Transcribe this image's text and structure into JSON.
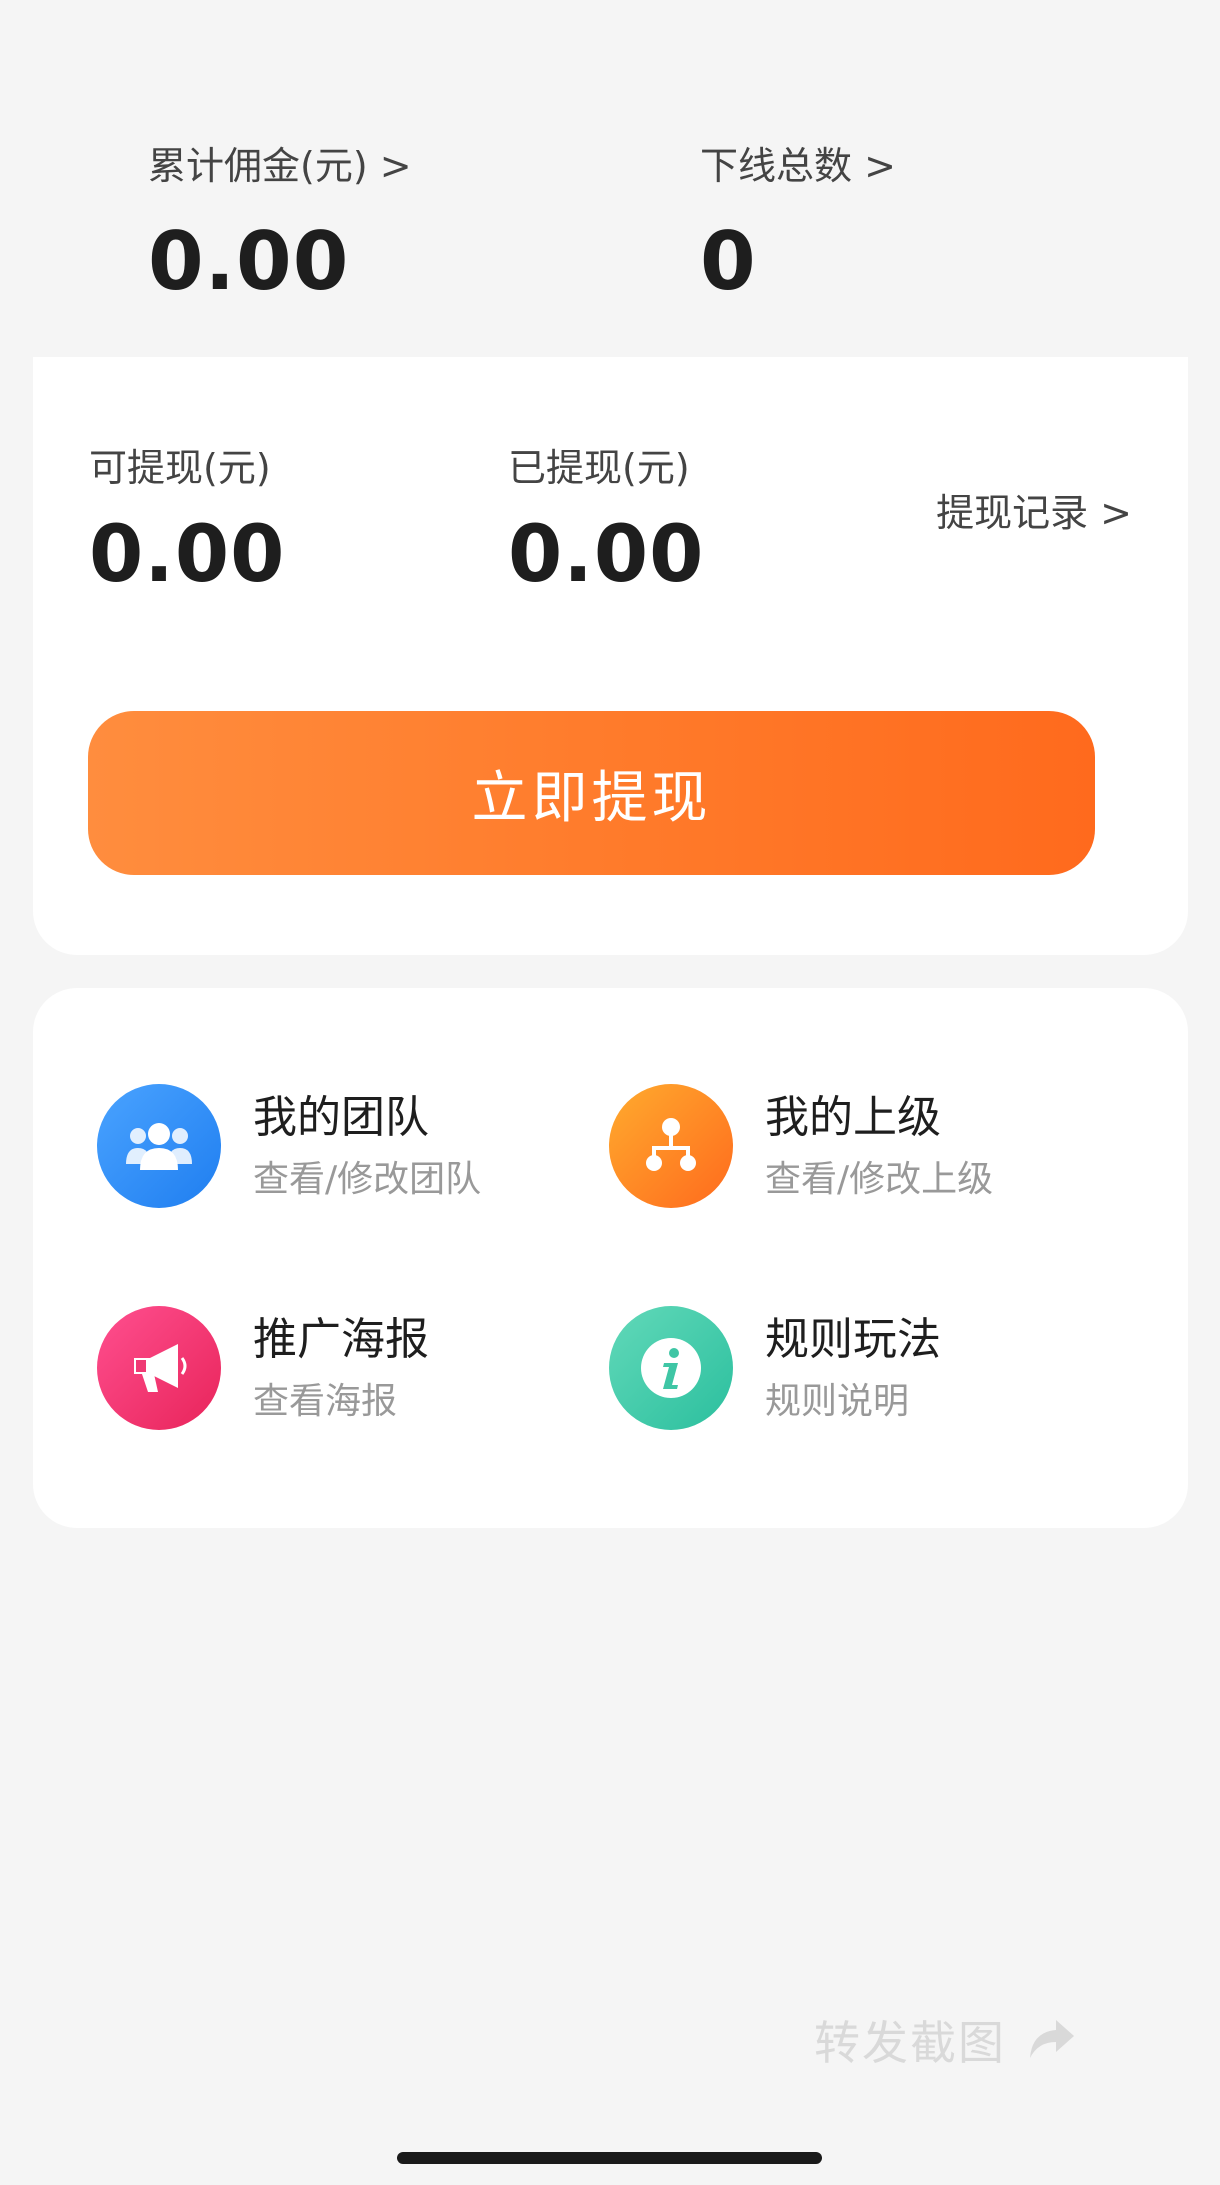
{
  "top_stats": {
    "commission": {
      "label": "累计佣金(元) >",
      "value": "0.00"
    },
    "downline": {
      "label": "下线总数 >",
      "value": "0"
    }
  },
  "withdraw": {
    "available": {
      "label": "可提现(元)",
      "value": "0.00"
    },
    "withdrawn": {
      "label": "已提现(元)",
      "value": "0.00"
    },
    "record_link": "提现记录 >",
    "button_label": "立即提现"
  },
  "menu": {
    "items": [
      {
        "title": "我的团队",
        "subtitle": "查看/修改团队",
        "icon": "team-icon"
      },
      {
        "title": "我的上级",
        "subtitle": "查看/修改上级",
        "icon": "hierarchy-icon"
      },
      {
        "title": "推广海报",
        "subtitle": "查看海报",
        "icon": "megaphone-icon"
      },
      {
        "title": "规则玩法",
        "subtitle": "规则说明",
        "icon": "info-icon"
      }
    ]
  },
  "share": {
    "label": "转发截图",
    "icon": "share-arrow-icon"
  },
  "colors": {
    "accent_orange": "#ff7a2a",
    "team_blue": "#2b8cf5",
    "superior_orange": "#ff8a24",
    "poster_pink": "#f0336f",
    "rules_teal": "#3fcaa8",
    "page_bg": "#f5f5f5"
  }
}
